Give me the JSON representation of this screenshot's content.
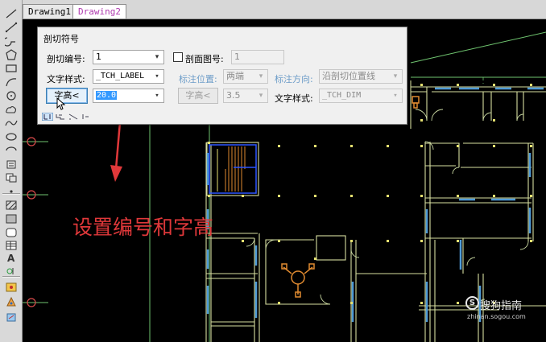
{
  "tabs": [
    {
      "label": "Drawing1",
      "active": false
    },
    {
      "label": "Drawing2",
      "active": true
    }
  ],
  "toolbar": {
    "icons": [
      "line-icon",
      "polyline-icon",
      "arc-icon",
      "polygon-icon",
      "rectangle-icon",
      "arc2-icon",
      "circle-icon",
      "revision-cloud-icon",
      "spline-icon",
      "ellipse-icon",
      "ellipse-arc-icon",
      "insert-block-icon",
      "make-block-icon",
      "point-icon",
      "hatch-icon",
      "gradient-icon",
      "region-icon",
      "table-icon",
      "text-icon",
      "add-selected-icon",
      "tianzheng-a-icon",
      "tianzheng-b-icon",
      "tianzheng-c-icon"
    ]
  },
  "dialog": {
    "title": "剖切符号",
    "row1": {
      "number_label": "剖切编号:",
      "number_value": "1",
      "section_checkbox_label": "剖面图号:",
      "section_checkbox_checked": false,
      "section_value": "1"
    },
    "row2": {
      "text_style_label": "文字样式:",
      "text_style_value": "_TCH_LABEL",
      "mark_pos_label": "标注位置:",
      "mark_pos_value": "两端",
      "mark_dir_label": "标注方向:",
      "mark_dir_value": "沿剖切位置线"
    },
    "row3": {
      "char_height_button": "字高<",
      "char_height_value": "20.0",
      "char_height_button2": "字高<",
      "char_height_value2": "3.5",
      "text_style_label2": "文字样式:",
      "text_style_value2": "_TCH_DIM"
    }
  },
  "caption": "设置编号和字高",
  "watermark": {
    "logo": "S",
    "main": "搜狗指南",
    "sub": "zhinan.sogou.com"
  },
  "colors": {
    "wall": "#d9e0a6",
    "door": "#c9d8a2",
    "window": "#4f9bd6",
    "axis": "#7cd07c",
    "bubble": "#e04040",
    "column": "#e0e070",
    "stair": "#e08a30",
    "blue_outline": "#2e56ff",
    "caption": "#e0383a",
    "arrow": "#e0383a"
  }
}
